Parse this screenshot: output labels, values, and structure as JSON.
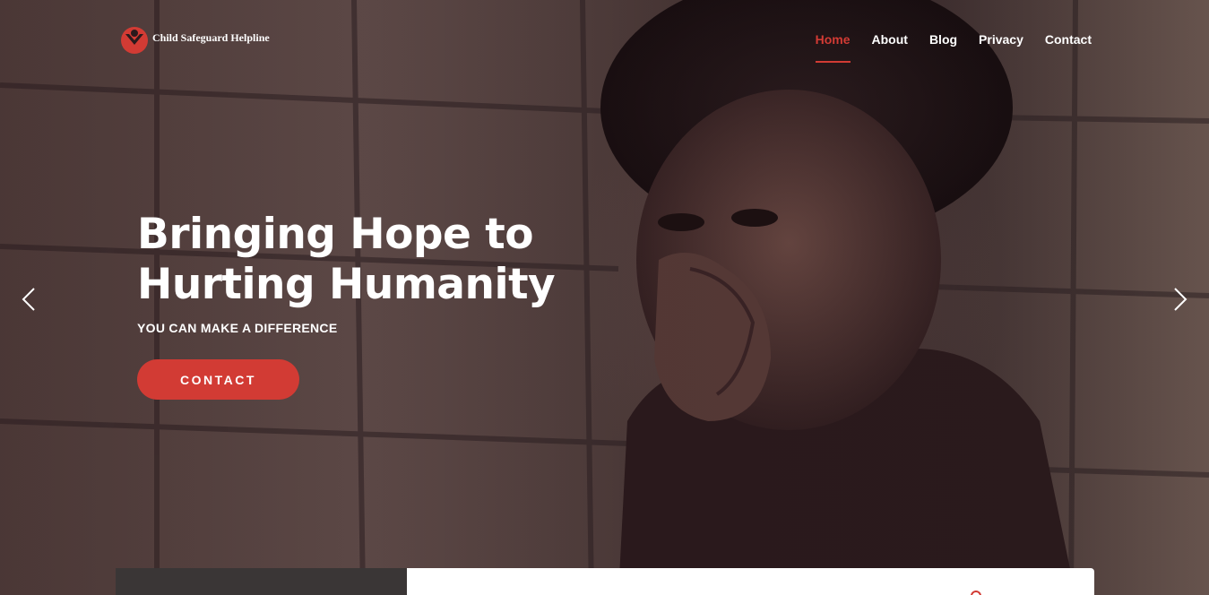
{
  "brand": {
    "name": "Child Safeguard Helpline",
    "accent_color": "#d23b34",
    "logo_icon": "heart-child-logo-icon"
  },
  "nav": {
    "items": [
      {
        "label": "Home",
        "active": true
      },
      {
        "label": "About",
        "active": false
      },
      {
        "label": "Blog",
        "active": false
      },
      {
        "label": "Privacy",
        "active": false
      },
      {
        "label": "Contact",
        "active": false
      }
    ]
  },
  "hero": {
    "headline_line1": "Bringing Hope to",
    "headline_line2": "Hurting Humanity",
    "subheadline": "YOU CAN MAKE A DIFFERENCE",
    "cta_label": "CONTACT",
    "prev_icon": "chevron-left-icon",
    "next_icon": "chevron-right-icon"
  }
}
